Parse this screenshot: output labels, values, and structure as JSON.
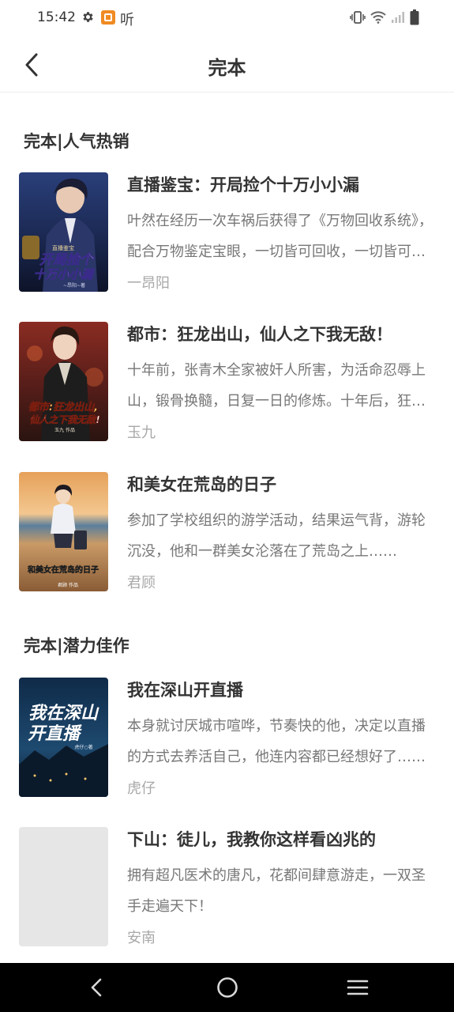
{
  "status_bar": {
    "time": "15:42",
    "ting_label": "听",
    "icons": [
      "gear-icon",
      "app-notification-icon",
      "vibrate-icon",
      "wifi-icon",
      "signal-icon",
      "battery-icon"
    ]
  },
  "header": {
    "title": "完本",
    "back_icon": "chevron-left-icon"
  },
  "sections": [
    {
      "title": "完本|人气热销",
      "books": [
        {
          "title": "直播鉴宝：开局捡个十万小小漏",
          "desc": "叶然在经历一次车祸后获得了《万物回收系统》，配合万物鉴定宝眼，一切皆可回收，一切皆可鉴定……",
          "author": "一昂阳",
          "cover": {
            "text_top": "直播鉴宝",
            "text_main1": "开局捡个",
            "text_main2": "十万小小漏",
            "text_author": "~昂阳~著"
          }
        },
        {
          "title": "都市：狂龙出山，仙人之下我无敌！",
          "desc": "十年前，张青木全家被奸人所害，为活命忍辱上山，锻骨换髓，日复一日的修炼。十年后，狂龙出山……",
          "author": "玉九",
          "cover": {
            "text_main1": "都市:狂龙出山,",
            "text_main2": "仙人之下我无敌!",
            "text_author": "玉九 作品"
          }
        },
        {
          "title": "和美女在荒岛的日子",
          "desc": "参加了学校组织的游学活动，结果运气背，游轮沉没，他和一群美女沦落在了荒岛之上……",
          "author": "君顾",
          "cover": {
            "text_main1": "和美女在荒岛的日子",
            "text_author": "君顾 作品"
          }
        }
      ]
    },
    {
      "title": "完本|潜力佳作",
      "books": [
        {
          "title": "我在深山开直播",
          "desc": "本身就讨厌城市喧哗，节奏快的他，决定以直播的方式去养活自己，他连内容都已经想好了……",
          "author": "虎仔",
          "cover": {
            "text_main1": "我在深山",
            "text_main2": "开直播",
            "text_author": "虎仔○著"
          }
        },
        {
          "title": "下山：徒儿，我教你这样看凶兆的",
          "desc": "拥有超凡医术的唐凡，花都间肆意游走，一双圣手走遍天下！",
          "author": "安南",
          "cover": {}
        }
      ]
    }
  ],
  "nav_bar": {
    "icons": [
      "back-triangle-icon",
      "home-circle-icon",
      "menu-lines-icon"
    ]
  },
  "colors": {
    "title_text": "#333333",
    "desc_text": "#777777",
    "author_text": "#a8a8a8",
    "divider": "#ececec",
    "nav_bg": "#000000"
  }
}
